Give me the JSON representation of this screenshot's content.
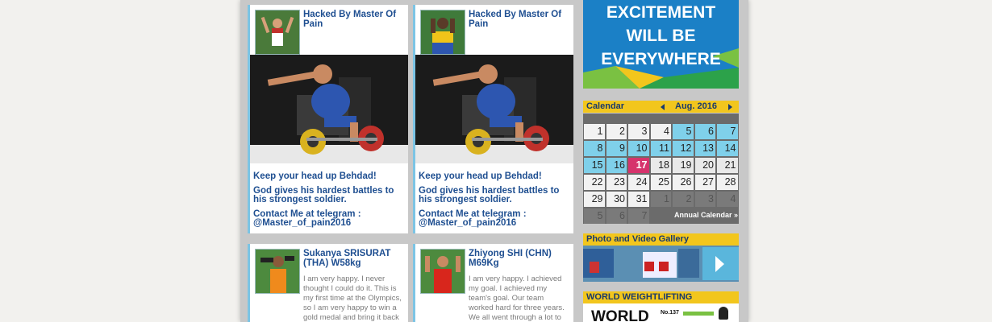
{
  "posts": [
    {
      "title": "Hacked By Master Of Pain",
      "messages": [
        "Keep your head up Behdad!",
        "God gives his hardest battles to his strongest soldier.",
        "Contact Me at telegram : @Master_of_pain2016"
      ]
    },
    {
      "title": "Hacked By Master Of Pain",
      "messages": [
        "Keep your head up Behdad!",
        "God gives his hardest battles to his strongest soldier.",
        "Contact Me at telegram : @Master_of_pain2016"
      ]
    },
    {
      "title": "Sukanya SRISURAT (THA) W58kg",
      "body": "I am very happy. I never thought I could do it. This is my first time at the Olympics, so I am very happy to win a gold medal and bring it back to Thailand."
    },
    {
      "title": "Zhiyong SHI (CHN) M69Kg",
      "body": "I am very happy. I achieved my goal. I achieved my team's goal. Our team worked hard for three years. We all went through a lot to get to this point."
    }
  ],
  "banner": {
    "lines": [
      "EXCITEMENT",
      "WILL BE",
      "EVERYWHERE"
    ]
  },
  "calendar": {
    "label": "Calendar",
    "prev_icon": "triangle-left",
    "next_icon": "triangle-right",
    "month": "Aug. 2016",
    "rows": [
      [
        "1",
        "2",
        "3",
        "4",
        "5",
        "6",
        "7"
      ],
      [
        "8",
        "9",
        "10",
        "11",
        "12",
        "13",
        "14"
      ],
      [
        "15",
        "16",
        "17",
        "18",
        "19",
        "20",
        "21"
      ],
      [
        "22",
        "23",
        "24",
        "25",
        "26",
        "27",
        "28"
      ],
      [
        "29",
        "30",
        "31",
        "1",
        "2",
        "3",
        "4"
      ],
      [
        "5",
        "6",
        "7"
      ]
    ],
    "annual_link": "Annual Calendar »"
  },
  "gallery": {
    "label": "Photo and Video Gallery",
    "next_icon": "play-arrow"
  },
  "weightlifting": {
    "label": "WORLD WEIGHTLIFTING",
    "logo_text": "WORLD",
    "issue": "No.137"
  },
  "colors": {
    "accent_yellow": "#f2c61d",
    "title_blue": "#1f4f91",
    "today_pink": "#d6336c",
    "olympic_day_blue": "#7fd0ea"
  }
}
